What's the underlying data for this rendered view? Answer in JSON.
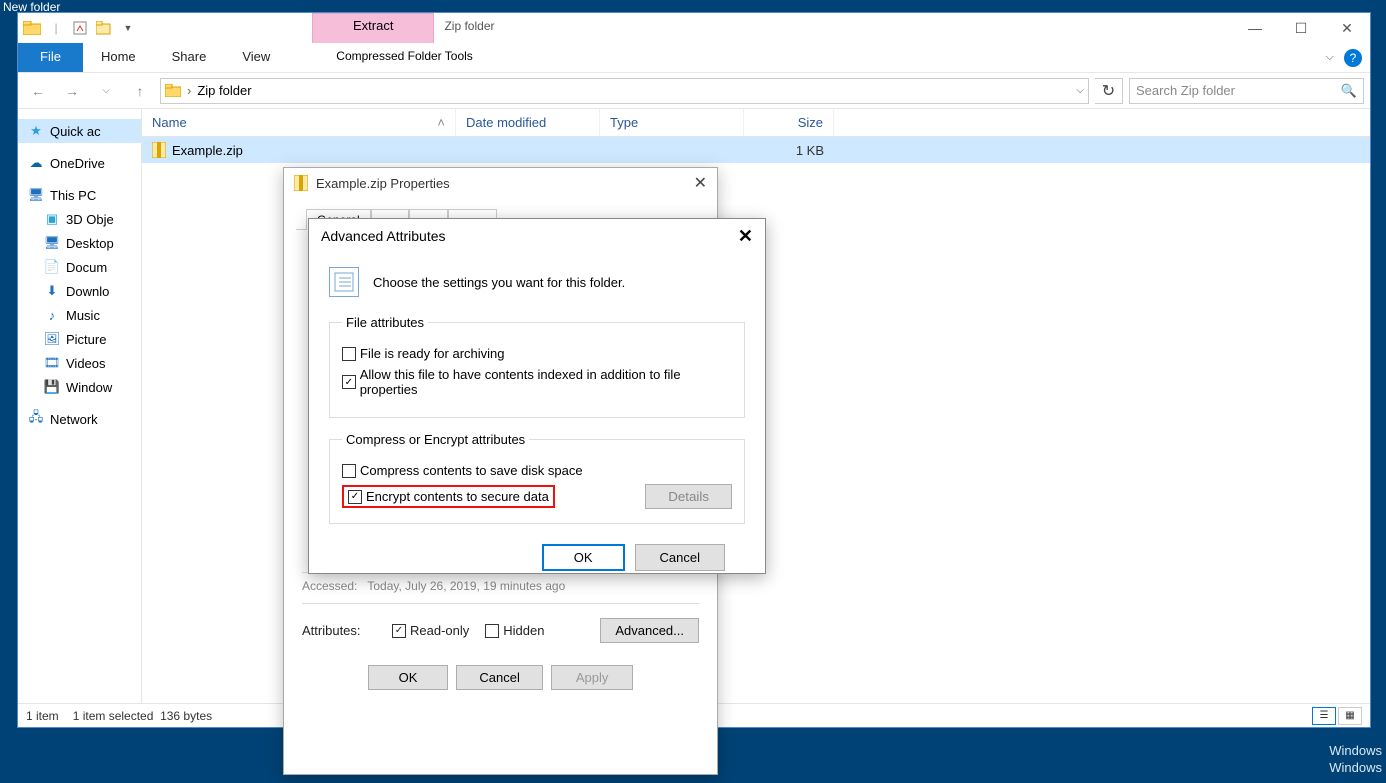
{
  "parentWindowTitle": "New folder",
  "explorer": {
    "extractTab": "Extract",
    "zipFolderTabLabel": "Zip folder",
    "toolsLabel": "Compressed Folder Tools",
    "fileTab": "File",
    "tabs": [
      "Home",
      "Share",
      "View"
    ],
    "breadcrumb": "Zip folder",
    "searchPlaceholder": "Search Zip folder",
    "columns": {
      "name": "Name",
      "date": "Date modified",
      "type": "Type",
      "size": "Size"
    },
    "row": {
      "name": "Example.zip",
      "date": "",
      "type": "",
      "size": "1 KB"
    },
    "status": {
      "count": "1 item",
      "selected": "1 item selected",
      "bytes": "136 bytes"
    }
  },
  "sidebar": {
    "quickAccess": "Quick ac",
    "oneDrive": "OneDrive",
    "thisPC": "This PC",
    "items": [
      "3D Obje",
      "Desktop",
      "Docum",
      "Downlo",
      "Music",
      "Picture",
      "Videos",
      "Window"
    ],
    "network": "Network"
  },
  "props": {
    "title": "Example.zip Properties",
    "tabGeneral": "General",
    "accessed": "Accessed:",
    "accessedVal": "Today, July 26, 2019, 19 minutes ago",
    "attrLabel": "Attributes:",
    "readOnly": "Read-only",
    "hidden": "Hidden",
    "advanced": "Advanced...",
    "ok": "OK",
    "cancel": "Cancel",
    "apply": "Apply"
  },
  "adv": {
    "title": "Advanced Attributes",
    "intro": "Choose the settings you want for this folder.",
    "fsFile": "File attributes",
    "archive": "File is ready for archiving",
    "index": "Allow this file to have contents indexed in addition to file properties",
    "fsCE": "Compress or Encrypt attributes",
    "compress": "Compress contents to save disk space",
    "encrypt": "Encrypt contents to secure data",
    "details": "Details",
    "ok": "OK",
    "cancel": "Cancel"
  },
  "watermark": {
    "l1": "Windows",
    "l2": "Windows"
  }
}
